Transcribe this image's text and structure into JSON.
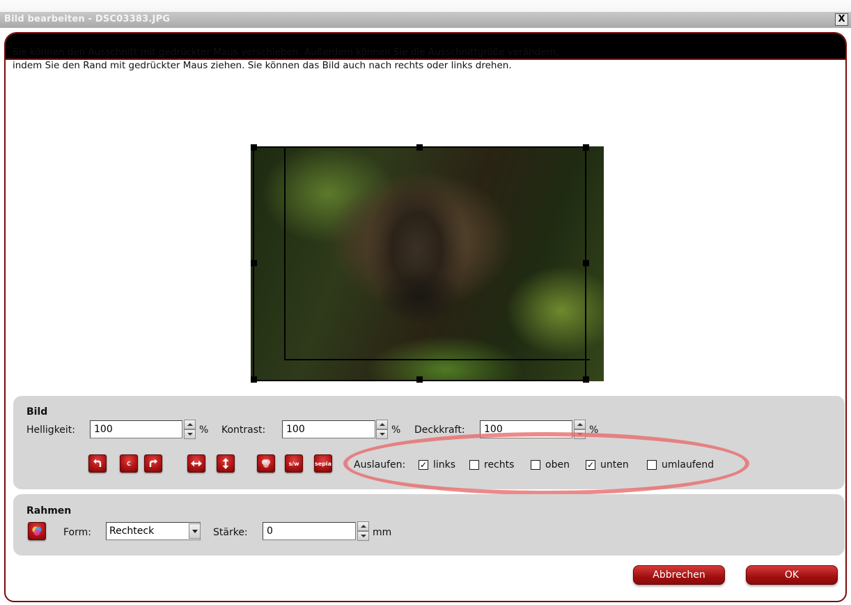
{
  "window": {
    "title": "Bild bearbeiten - DSC03383.JPG",
    "close_label": "X"
  },
  "description": {
    "line1": "Sie können den Ausschnitt mit gedrückter Maus verschieben. Außerdem können Sie die Ausschnittgröße verändern,",
    "line2": "indem Sie den Rand mit gedrückter Maus ziehen. Sie können das Bild auch nach rechts oder links drehen."
  },
  "bild": {
    "heading": "Bild",
    "helligkeit_label": "Helligkeit:",
    "helligkeit_value": "100",
    "helligkeit_unit": "%",
    "kontrast_label": "Kontrast:",
    "kontrast_value": "100",
    "kontrast_unit": "%",
    "deckkraft_label": "Deckkraft:",
    "deckkraft_value": "100",
    "deckkraft_unit": "%",
    "tools": {
      "reset_label": "C",
      "sw_label": "s/w",
      "sepia_label": "sepia"
    },
    "auslaufen_label": "Auslaufen:",
    "auslaufen_options": [
      {
        "label": "links",
        "checked": true,
        "mark": "✓"
      },
      {
        "label": "rechts",
        "checked": false,
        "mark": ""
      },
      {
        "label": "oben",
        "checked": false,
        "mark": ""
      },
      {
        "label": "unten",
        "checked": true,
        "mark": "✓"
      },
      {
        "label": "umlaufend",
        "checked": false,
        "mark": ""
      }
    ]
  },
  "rahmen": {
    "heading": "Rahmen",
    "form_label": "Form:",
    "form_value": "Rechteck",
    "staerke_label": "Stärke:",
    "staerke_value": "0",
    "staerke_unit": "mm"
  },
  "actions": {
    "cancel_label": "Abbrechen",
    "ok_label": "OK"
  },
  "colors": {
    "accent_red": "#b11414",
    "panel_gray": "#d6d6d6",
    "highlight": "#e86c6c"
  }
}
